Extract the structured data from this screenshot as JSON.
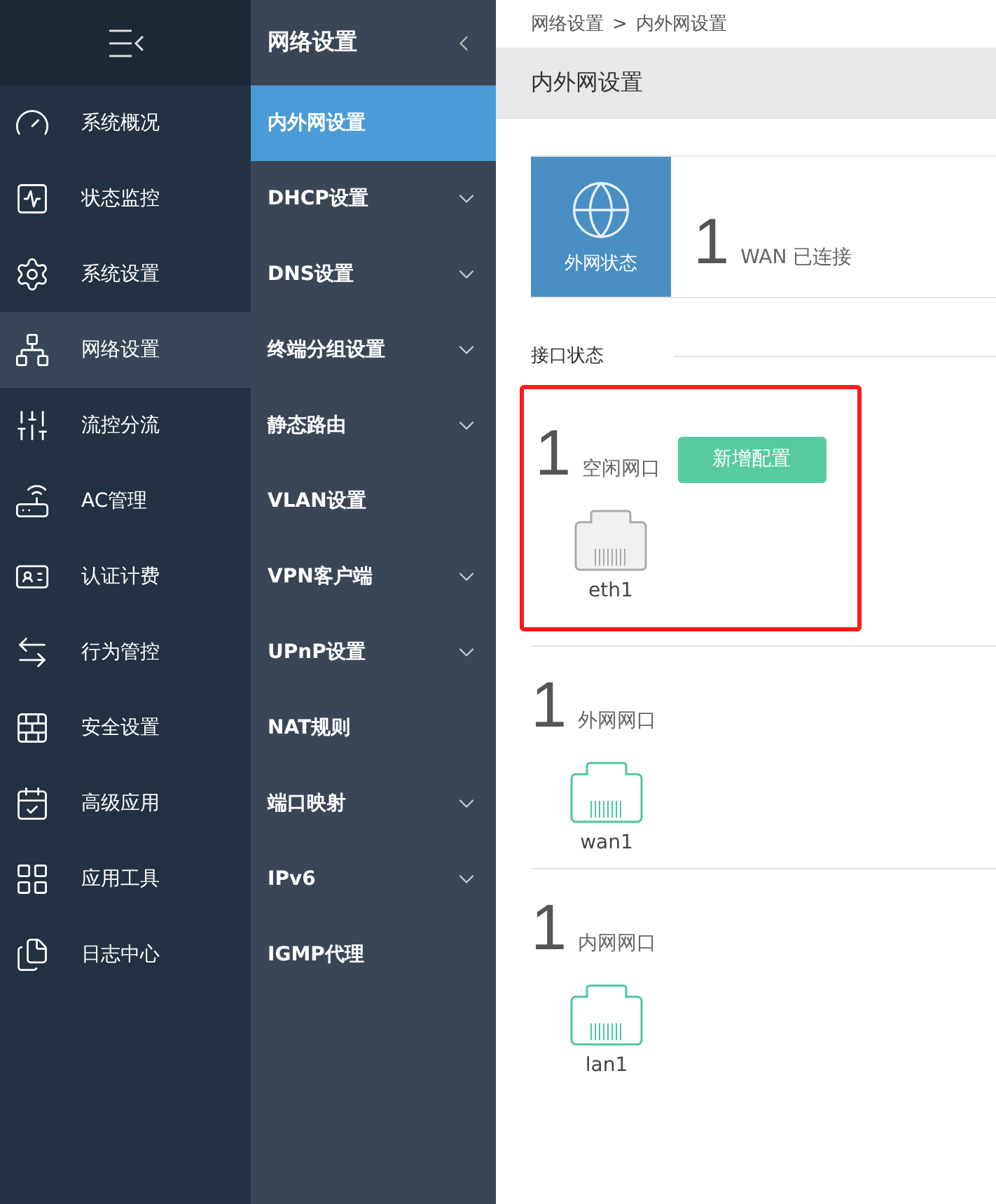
{
  "sidebar": {
    "items": [
      {
        "label": "系统概况",
        "selected": false
      },
      {
        "label": "状态监控",
        "selected": false
      },
      {
        "label": "系统设置",
        "selected": false
      },
      {
        "label": "网络设置",
        "selected": true
      },
      {
        "label": "流控分流",
        "selected": false
      },
      {
        "label": "AC管理",
        "selected": false
      },
      {
        "label": "认证计费",
        "selected": false
      },
      {
        "label": "行为管控",
        "selected": false
      },
      {
        "label": "安全设置",
        "selected": false
      },
      {
        "label": "高级应用",
        "selected": false
      },
      {
        "label": "应用工具",
        "selected": false
      },
      {
        "label": "日志中心",
        "selected": false
      }
    ]
  },
  "submenu": {
    "title": "网络设置",
    "items": [
      {
        "label": "内外网设置",
        "selected": true,
        "expandable": false
      },
      {
        "label": "DHCP设置",
        "selected": false,
        "expandable": true
      },
      {
        "label": "DNS设置",
        "selected": false,
        "expandable": true
      },
      {
        "label": "终端分组设置",
        "selected": false,
        "expandable": true
      },
      {
        "label": "静态路由",
        "selected": false,
        "expandable": true
      },
      {
        "label": "VLAN设置",
        "selected": false,
        "expandable": false
      },
      {
        "label": "VPN客户端",
        "selected": false,
        "expandable": true
      },
      {
        "label": "UPnP设置",
        "selected": false,
        "expandable": true
      },
      {
        "label": "NAT规则",
        "selected": false,
        "expandable": false
      },
      {
        "label": "端口映射",
        "selected": false,
        "expandable": true
      },
      {
        "label": "IPv6",
        "selected": false,
        "expandable": true
      },
      {
        "label": "IGMP代理",
        "selected": false,
        "expandable": false
      }
    ]
  },
  "breadcrumb": [
    "网络设置",
    "内外网设置"
  ],
  "breadcrumb_separator": ">",
  "page_title": "内外网设置",
  "wan_status": {
    "tile_label": "外网状态",
    "count": "1",
    "text": "WAN 已连接"
  },
  "interface_section": {
    "title": "接口状态",
    "groups": [
      {
        "count": "1",
        "label": "空闲网口",
        "button": "新增配置",
        "highlighted": true,
        "ports": [
          {
            "name": "eth1",
            "kind": "idle"
          }
        ]
      },
      {
        "count": "1",
        "label": "外网网口",
        "highlighted": false,
        "ports": [
          {
            "name": "wan1",
            "kind": "active"
          }
        ]
      },
      {
        "count": "1",
        "label": "内网网口",
        "highlighted": false,
        "ports": [
          {
            "name": "lan1",
            "kind": "active"
          }
        ]
      }
    ]
  }
}
